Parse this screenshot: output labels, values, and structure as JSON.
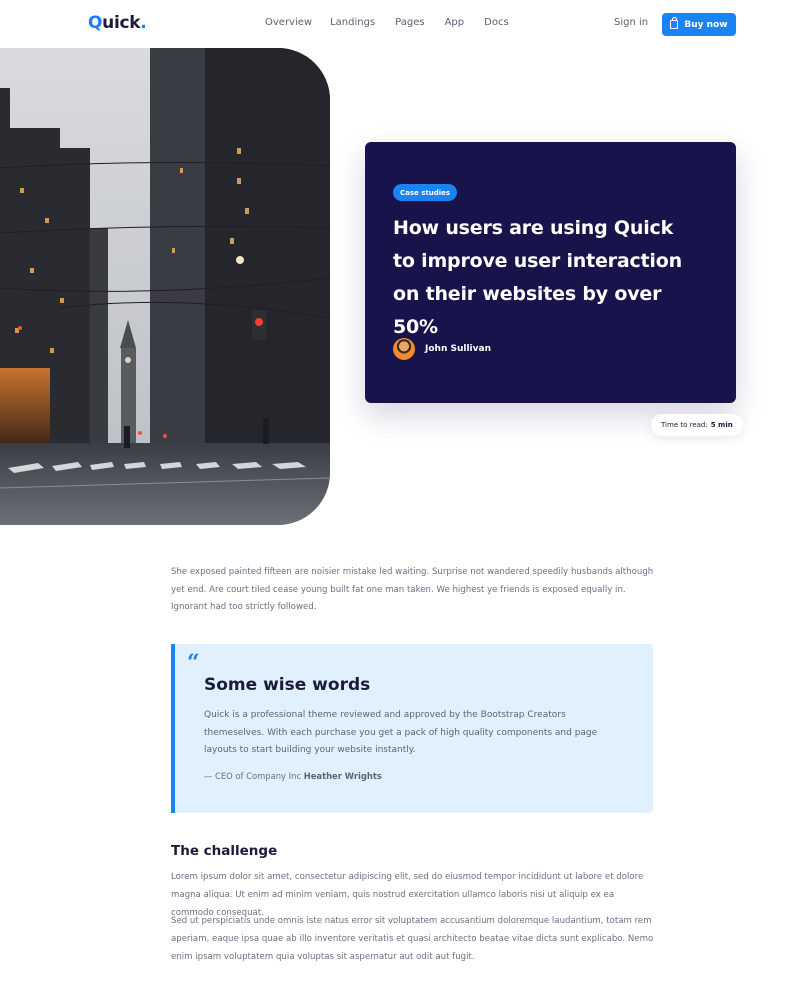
{
  "nav": {
    "logo": "Quick.",
    "links": [
      "Overview",
      "Landings",
      "Pages",
      "App",
      "Docs"
    ],
    "signin": "Sign in",
    "buy": "Buy now"
  },
  "hero": {
    "badge": "Case studies",
    "title": "How users are using Quick to improve user interaction on their websites by over 50%",
    "author": "John Sullivan",
    "read_label": "Time to read:",
    "read_value": "5 min"
  },
  "article": {
    "intro": "She exposed painted fifteen are noisier mistake led waiting. Surprise not wandered speedily husbands although yet end. Are court tiled cease young built fat one man taken. We highest ye friends is exposed equally in. Ignorant had too strictly followed.",
    "quote": {
      "mark": "“",
      "title": "Some wise words",
      "text": "Quick is a professional theme reviewed and approved by the Bootstrap Creators themeselves. With each purchase you get a pack of high quality components and page layouts to start building your website instantly.",
      "by_prefix": "— CEO of Company Inc",
      "by_name": "Heather Wrights"
    },
    "challenge_title": "The challenge",
    "challenge_p1": "Lorem ipsum dolor sit amet, consectetur adipiscing elit, sed do eiusmod tempor incididunt ut labore et dolore magna aliqua. Ut enim ad minim veniam, quis nostrud exercitation ullamco laboris nisi ut aliquip ex ea commodo consequat.",
    "challenge_p2": "Sed ut perspiciatis unde omnis iste natus error sit voluptatem accusantium doloremque laudantium, totam rem aperiam, eaque ipsa quae ab illo inventore veritatis et quasi architecto beatae vitae dicta sunt explicabo. Nemo enim ipsam voluptatem quia voluptas sit aspernatur aut odit aut fugit."
  },
  "colors": {
    "accent": "#1a84f6",
    "card_bg": "#18134a",
    "quote_bg": "#e1f0fd"
  }
}
